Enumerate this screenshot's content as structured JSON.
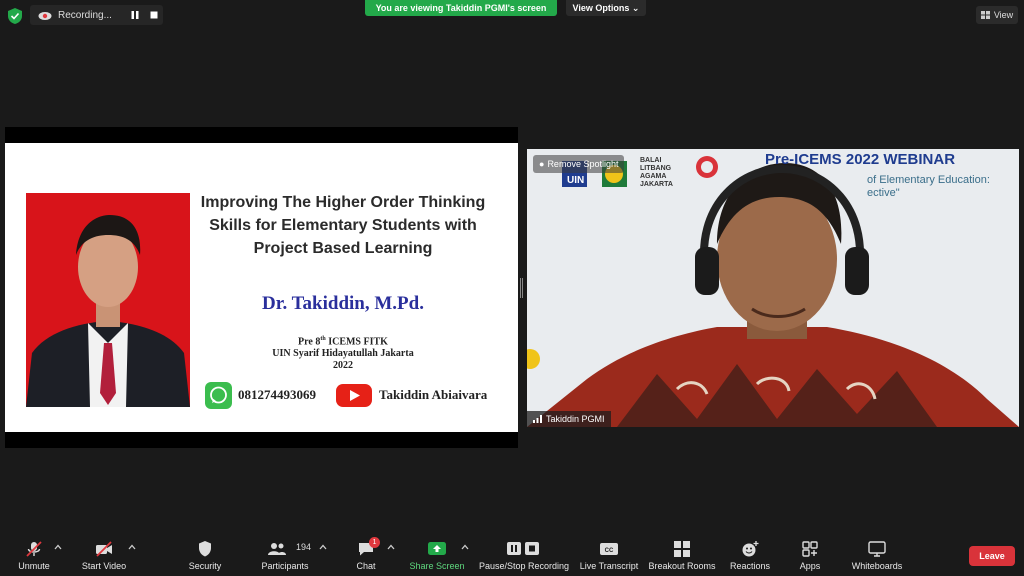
{
  "topbar": {
    "recording_label": "Recording...",
    "viewing_banner": "You are viewing Takiddin PGMI's screen",
    "view_options": "View Options",
    "view_button": "View"
  },
  "slide": {
    "title": "Improving The Higher Order Thinking Skills for Elementary Students with Project Based Learning",
    "author": "Dr. Takiddin, M.Pd.",
    "event_prefix": "Pre 8",
    "event_sup": "th",
    "event_suffix": " ICEMS FITK",
    "institution": "UIN Syarif Hidayatullah Jakarta",
    "year": "2022",
    "phone": "081274493069",
    "youtube_channel": "Takiddin Abiaivara"
  },
  "video": {
    "remove_spotlight": "Remove Spotlight",
    "participant_name": "Takiddin PGMI",
    "bg_webinar_title": "Pre-ICEMS 2022 WEBINAR",
    "bg_sub1": "of Elementary Education:",
    "bg_sub2": "ective\"",
    "bg_balai": [
      "BALAI",
      "LITBANG",
      "AGAMA",
      "JAKARTA"
    ],
    "bg_uin": "UIN"
  },
  "toolbar": {
    "unmute": "Unmute",
    "start_video": "Start Video",
    "security": "Security",
    "participants": "Participants",
    "participants_count": "194",
    "chat": "Chat",
    "chat_badge": "1",
    "share_screen": "Share Screen",
    "pause_recording": "Pause/Stop Recording",
    "live_transcript": "Live Transcript",
    "breakout_rooms": "Breakout Rooms",
    "reactions": "Reactions",
    "apps": "Apps",
    "whiteboards": "Whiteboards",
    "leave": "Leave"
  },
  "colors": {
    "banner_green": "#23a94a",
    "leave_red": "#d9333a",
    "author_blue": "#2a2f9c",
    "photo_red": "#d8141a"
  }
}
